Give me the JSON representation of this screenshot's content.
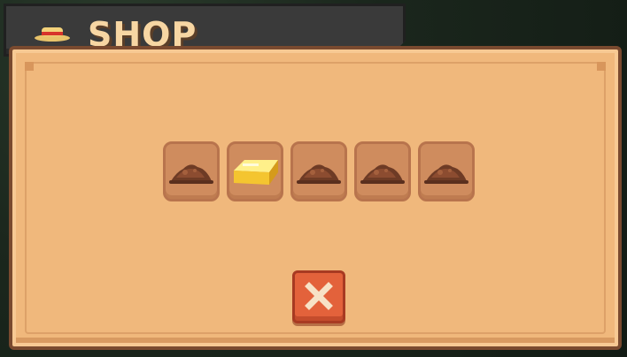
{
  "header": {
    "title": "SHOP",
    "icon": "straw-hat-icon"
  },
  "items": [
    {
      "icon": "dirt-pile-icon"
    },
    {
      "icon": "gold-bar-icon"
    },
    {
      "icon": "dirt-pile-icon"
    },
    {
      "icon": "dirt-pile-icon"
    },
    {
      "icon": "dirt-pile-icon"
    }
  ],
  "actions": {
    "close_icon": "close-icon"
  },
  "colors": {
    "panel": "#f0b87c",
    "slot": "#cf8c5e",
    "close_button": "#e3623b",
    "title_bar": "#3a3a3a",
    "title_text": "#f7d6a3"
  }
}
